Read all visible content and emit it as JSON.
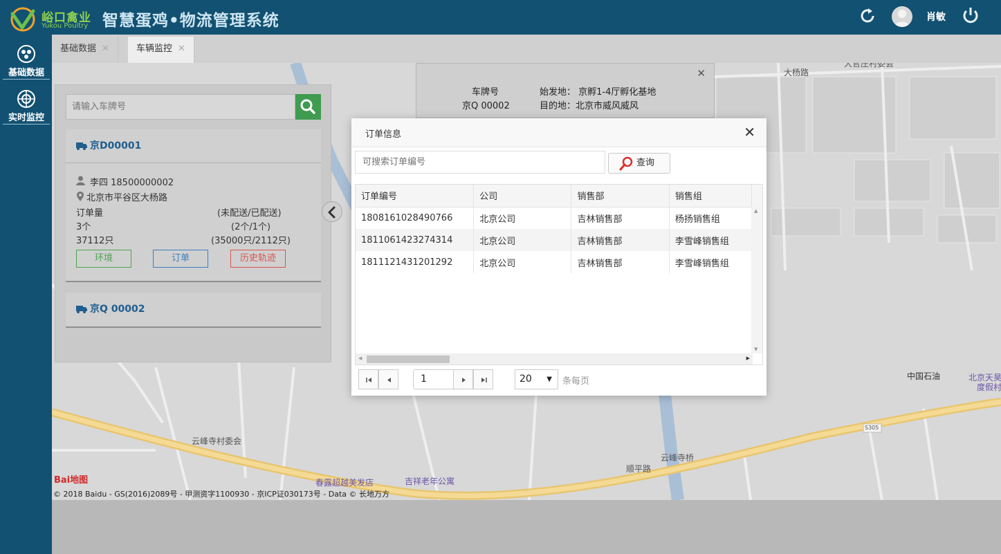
{
  "header": {
    "logo_text": "峪口禽业",
    "logo_sub": "Yukou Poultry",
    "app_title": "智慧蛋鸡•物流管理系统",
    "user_name": "肖敏"
  },
  "sidebar": {
    "items": [
      {
        "label": "基础数据"
      },
      {
        "label": "实时监控"
      }
    ]
  },
  "tabs": [
    {
      "label": "基础数据"
    },
    {
      "label": "车辆监控"
    }
  ],
  "vehicle_panel": {
    "search_placeholder": "请输入车牌号",
    "vehicles": [
      {
        "plate": "京D00001",
        "driver": "李四 18500000002",
        "address": "北京市平谷区大杨路",
        "order_label": "订单量",
        "order_status_label": "(未配送/已配送)",
        "order_count": "3个",
        "order_split": "(2个/1个)",
        "qty": "37112只",
        "qty_split": "(35000只/2112只)",
        "btn_env": "环境",
        "btn_order": "订单",
        "btn_history": "历史轨迹"
      },
      {
        "plate": "京Q 00002"
      }
    ]
  },
  "info_window": {
    "plate_label": "车牌号",
    "plate": "京Q 00002",
    "origin": "始发地： 京孵1-4厅孵化基地",
    "destination": "目的地：北京市威风威风"
  },
  "modal": {
    "title": "订单信息",
    "search_placeholder": "可搜索订单编号",
    "query_label": "查询",
    "columns": [
      "订单编号",
      "公司",
      "销售部",
      "销售组"
    ],
    "rows": [
      [
        "1808161028490766",
        "北京公司",
        "吉林销售部",
        "杨扬销售组"
      ],
      [
        "1811061423274314",
        "北京公司",
        "吉林销售部",
        "李雪峰销售组"
      ],
      [
        "1811121431201292",
        "北京公司",
        "吉林销售部",
        "李雪峰销售组"
      ]
    ],
    "pager": {
      "page": "1",
      "page_size": "20",
      "per_page_label": "条每页"
    }
  },
  "map": {
    "labels": {
      "dayang_road": "大杨路",
      "village_top": "大官庄村委会",
      "yunfeng_village": "云峰寺村委会",
      "yunfeng_bridge": "云峰寺桥",
      "shunping_road": "顺平路",
      "s305": "S305",
      "sinopec": "中国石油",
      "resort": "北京天昊",
      "resort2": "度假村",
      "chunlu": "春露超越美发店",
      "jixiang": "吉祥老年公寓"
    },
    "baidu_logo": "Bai地图",
    "copyright": "© 2018 Baidu - GS(2016)2089号 - 甲测资字1100930 - 京ICP证030173号 - Data © 长地万方"
  },
  "colors": {
    "header_bg": "#125172",
    "accent_green": "#3f9b4f",
    "link_blue": "#1f5e8f",
    "danger": "#d9534f"
  }
}
